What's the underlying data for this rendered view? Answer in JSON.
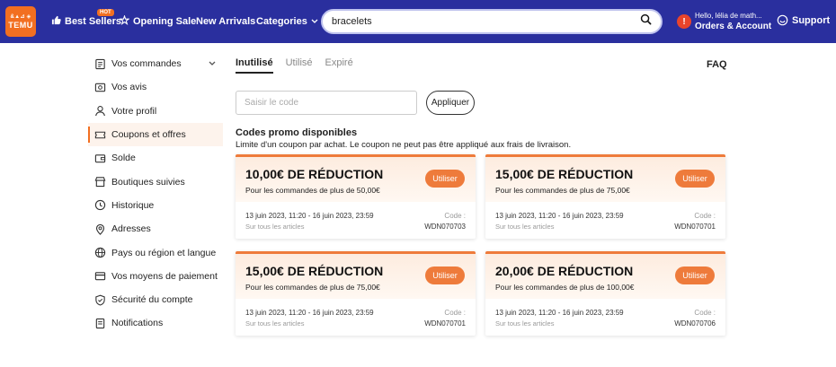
{
  "header": {
    "logo_line1": "&▲⊿ ◈",
    "logo_line2": "TEMU",
    "hot_badge": "HOT",
    "nav": [
      {
        "label": "Best Sellers",
        "icon": "thumbs-up-icon"
      },
      {
        "label": "Opening Sale",
        "icon": "star-icon"
      },
      {
        "label": "New Arrivals"
      },
      {
        "label": "Categories",
        "icon": "chevron-down-icon"
      }
    ],
    "search_value": "bracelets",
    "account_greeting": "Hello, lélia de math...",
    "account_label": "Orders & Account",
    "alert_mark": "!",
    "support_label": "Support"
  },
  "sidebar": {
    "items": [
      {
        "label": "Vos commandes",
        "icon": "orders-icon",
        "expandable": true
      },
      {
        "label": "Vos avis",
        "icon": "reviews-icon"
      },
      {
        "label": "Votre profil",
        "icon": "profile-icon"
      },
      {
        "label": "Coupons et offres",
        "icon": "coupon-icon",
        "active": true
      },
      {
        "label": "Solde",
        "icon": "wallet-icon"
      },
      {
        "label": "Boutiques suivies",
        "icon": "store-icon"
      },
      {
        "label": "Historique",
        "icon": "clock-icon"
      },
      {
        "label": "Adresses",
        "icon": "location-icon"
      },
      {
        "label": "Pays ou région et langue",
        "icon": "globe-icon"
      },
      {
        "label": "Vos moyens de paiement",
        "icon": "card-icon"
      },
      {
        "label": "Sécurité du compte",
        "icon": "shield-icon"
      },
      {
        "label": "Notifications",
        "icon": "bell-icon"
      }
    ]
  },
  "tabs": [
    "Inutilisé",
    "Utilisé",
    "Expiré"
  ],
  "faq_label": "FAQ",
  "code_input": {
    "placeholder": "Saisir le code",
    "button": "Appliquer"
  },
  "promo": {
    "title": "Codes promo disponibles",
    "note": "Limite d'un coupon par achat. Le coupon ne peut pas être appliqué aux frais de livraison."
  },
  "coupons": [
    {
      "amount": "10,00€ DE RÉDUCTION",
      "condition": "Pour les commandes de plus de 50,00€",
      "button": "Utiliser",
      "dates": "13 juin 2023, 11:20 - 16 juin 2023, 23:59",
      "scope": "Sur tous les articles",
      "code_label": "Code :",
      "code": "WDN070703"
    },
    {
      "amount": "15,00€ DE RÉDUCTION",
      "condition": "Pour les commandes de plus de 75,00€",
      "button": "Utiliser",
      "dates": "13 juin 2023, 11:20 - 16 juin 2023, 23:59",
      "scope": "Sur tous les articles",
      "code_label": "Code :",
      "code": "WDN070701"
    },
    {
      "amount": "15,00€ DE RÉDUCTION",
      "condition": "Pour les commandes de plus de 75,00€",
      "button": "Utiliser",
      "dates": "13 juin 2023, 11:20 - 16 juin 2023, 23:59",
      "scope": "Sur tous les articles",
      "code_label": "Code :",
      "code": "WDN070701"
    },
    {
      "amount": "20,00€ DE RÉDUCTION",
      "condition": "Pour les commandes de plus de 100,00€",
      "button": "Utiliser",
      "dates": "13 juin 2023, 11:20 - 16 juin 2023, 23:59",
      "scope": "Sur tous les articles",
      "code_label": "Code :",
      "code": "WDN070706"
    }
  ],
  "colors": {
    "header_bg": "#2a2f9e",
    "accent": "#ee7b3b",
    "brand_orange": "#f26f21"
  }
}
